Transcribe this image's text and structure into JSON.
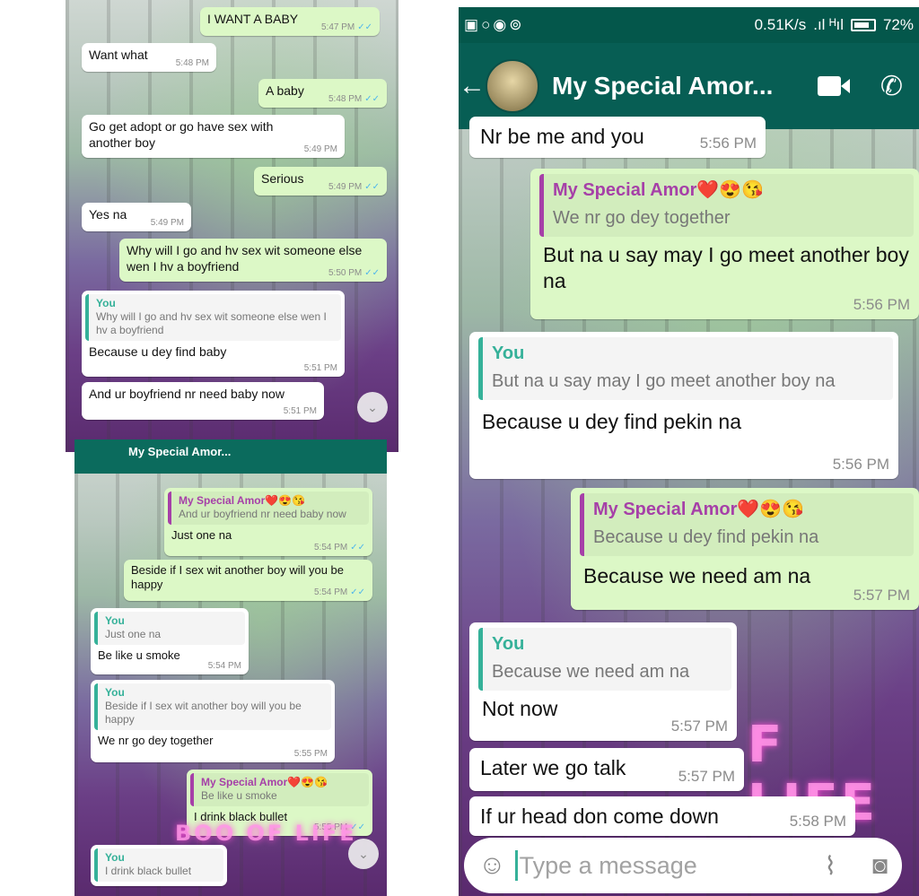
{
  "panel1": {
    "messages": [
      {
        "text": "I WANT A BABY",
        "time": "5:47 PM",
        "ticks": "✓✓"
      },
      {
        "text": "Want what",
        "time": "5:48 PM"
      },
      {
        "text": "A baby",
        "time": "5:48 PM",
        "ticks": "✓✓"
      },
      {
        "text": "Go get adopt or go have sex with another boy",
        "time": "5:49 PM"
      },
      {
        "text": "Serious",
        "time": "5:49 PM",
        "ticks": "✓✓"
      },
      {
        "text": "Yes na",
        "time": "5:49 PM"
      },
      {
        "text": "Why will I go and hv sex wit someone else wen I hv a boyfriend",
        "time": "5:50 PM",
        "ticks": "✓✓"
      },
      {
        "quote_author": "You",
        "quote_text": "Why will I go and hv sex wit someone else wen I hv a boyfriend",
        "text": "Because u dey find baby",
        "time": "5:51 PM"
      },
      {
        "text": "And ur boyfriend nr need baby now",
        "time": "5:51 PM"
      }
    ],
    "scroll_icon": "chevron-down"
  },
  "panel2": {
    "header_title": "My Special Amor...",
    "messages": [
      {
        "quote_author": "My Special Amor❤️😍😘",
        "quote_text": "And ur boyfriend nr need baby now",
        "text": "Just one na",
        "time": "5:54 PM",
        "ticks": "✓✓"
      },
      {
        "text": "Beside if I sex wit another boy will you be happy",
        "time": "5:54 PM",
        "ticks": "✓✓"
      },
      {
        "quote_author": "You",
        "quote_text": "Just one na",
        "text": "Be like u smoke",
        "time": "5:54 PM"
      },
      {
        "quote_author": "You",
        "quote_text": "Beside if I sex wit another boy will you be happy",
        "text": "We nr go dey together",
        "time": "5:55 PM"
      },
      {
        "quote_author": "My Special Amor❤️😍😘",
        "quote_text": "Be like u smoke",
        "text": "I drink black bullet",
        "time": "5:55 PM",
        "ticks": "✓✓"
      },
      {
        "quote_author": "You",
        "quote_text": "I drink black bullet"
      }
    ],
    "overlay_text": "BOO OF LIFE"
  },
  "panel3": {
    "status": {
      "network": "0.51K/s",
      "signal": ".ıl ᴴıl",
      "battery": "72%"
    },
    "contact_name": "My Special Amor...",
    "messages": [
      {
        "text": "Nr be me and you",
        "time": "5:56 PM"
      },
      {
        "quote_author": "My Special Amor❤️😍😘",
        "quote_text": "We nr go dey together",
        "text": "But na u say may I go meet another boy na",
        "time": "5:56 PM"
      },
      {
        "quote_author": "You",
        "quote_text": "But na u say may I go meet another boy na",
        "text": "Because u dey find pekin na",
        "time": "5:56 PM"
      },
      {
        "quote_author": "My Special Amor❤️😍😘",
        "quote_text": "Because u dey find pekin na",
        "text": "Because we need am na",
        "time": "5:57 PM"
      },
      {
        "quote_author": "You",
        "quote_text": "Because we need am na",
        "text": "Not now",
        "time": "5:57 PM"
      },
      {
        "text": "Later we go talk",
        "time": "5:57 PM"
      },
      {
        "text": "If ur head don come down",
        "time": "5:58 PM"
      }
    ],
    "overlay_text": "F LIFE",
    "input_placeholder": "Type a message"
  },
  "colors": {
    "header": "#075e54",
    "outgoing": "#dcf8c6",
    "incoming": "#ffffff",
    "quote_you": "#35b199",
    "quote_contact": "#a640a8"
  }
}
